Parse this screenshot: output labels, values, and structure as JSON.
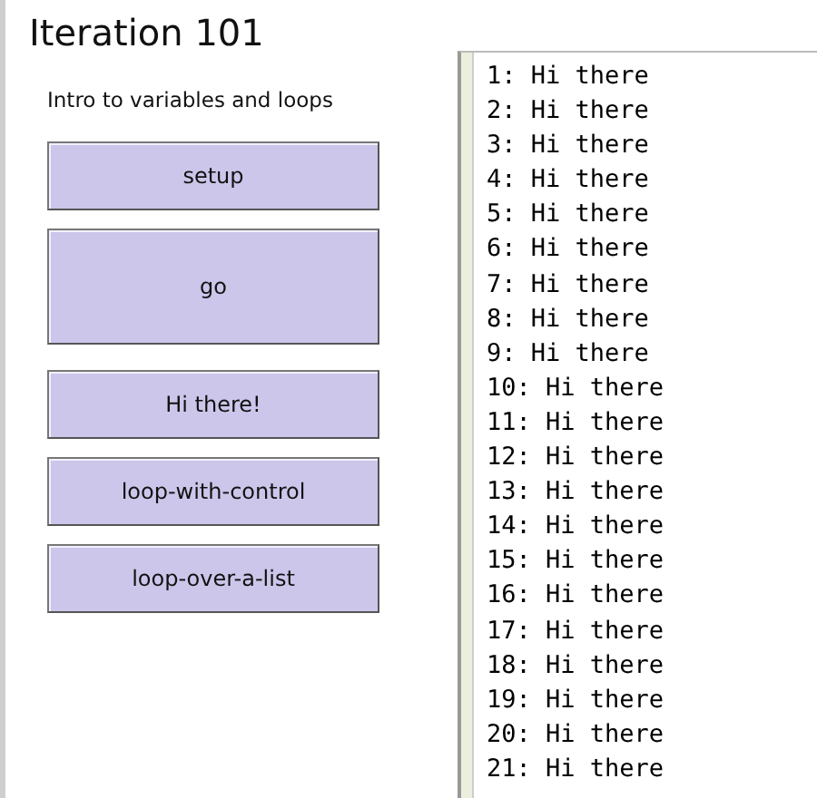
{
  "title": "Iteration 101",
  "note": "Intro to variables and loops",
  "buttons": [
    {
      "label": "setup",
      "kind": "once"
    },
    {
      "label": "go",
      "kind": "tall"
    },
    {
      "label": "Hi there!",
      "kind": "once"
    },
    {
      "label": "loop-with-control",
      "kind": "once"
    },
    {
      "label": "loop-over-a-list",
      "kind": "once"
    }
  ],
  "output_lines": [
    "1: Hi there",
    "2: Hi there",
    "3: Hi there",
    "4: Hi there",
    "5: Hi there",
    "6: Hi there",
    "7: Hi there",
    "8: Hi there",
    "9: Hi there",
    "10: Hi there",
    "11: Hi there",
    "12: Hi there",
    "13: Hi there",
    "14: Hi there",
    "15: Hi there",
    "16: Hi there",
    "17: Hi there",
    "18: Hi there",
    "19: Hi there",
    "20: Hi there",
    "21: Hi there"
  ]
}
